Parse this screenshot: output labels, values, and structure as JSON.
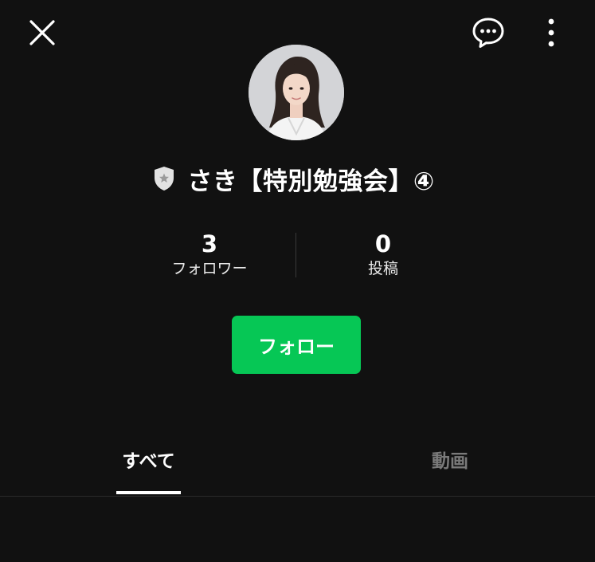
{
  "header": {
    "close_icon": "close-icon",
    "chat_icon": "chat-bubble-icon",
    "more_icon": "more-vertical-icon"
  },
  "profile": {
    "badge_icon": "shield-star-icon",
    "name": "さき【特別勉強会】④"
  },
  "stats": {
    "followers": {
      "value": "3",
      "label": "フォロワー"
    },
    "posts": {
      "value": "0",
      "label": "投稿"
    }
  },
  "follow_button": {
    "label": "フォロー",
    "color": "#06c755"
  },
  "tabs": [
    {
      "label": "すべて",
      "active": true
    },
    {
      "label": "動画",
      "active": false
    }
  ],
  "colors": {
    "background": "#111111",
    "accent": "#06c755",
    "inactive_tab": "#7a7a7a"
  }
}
